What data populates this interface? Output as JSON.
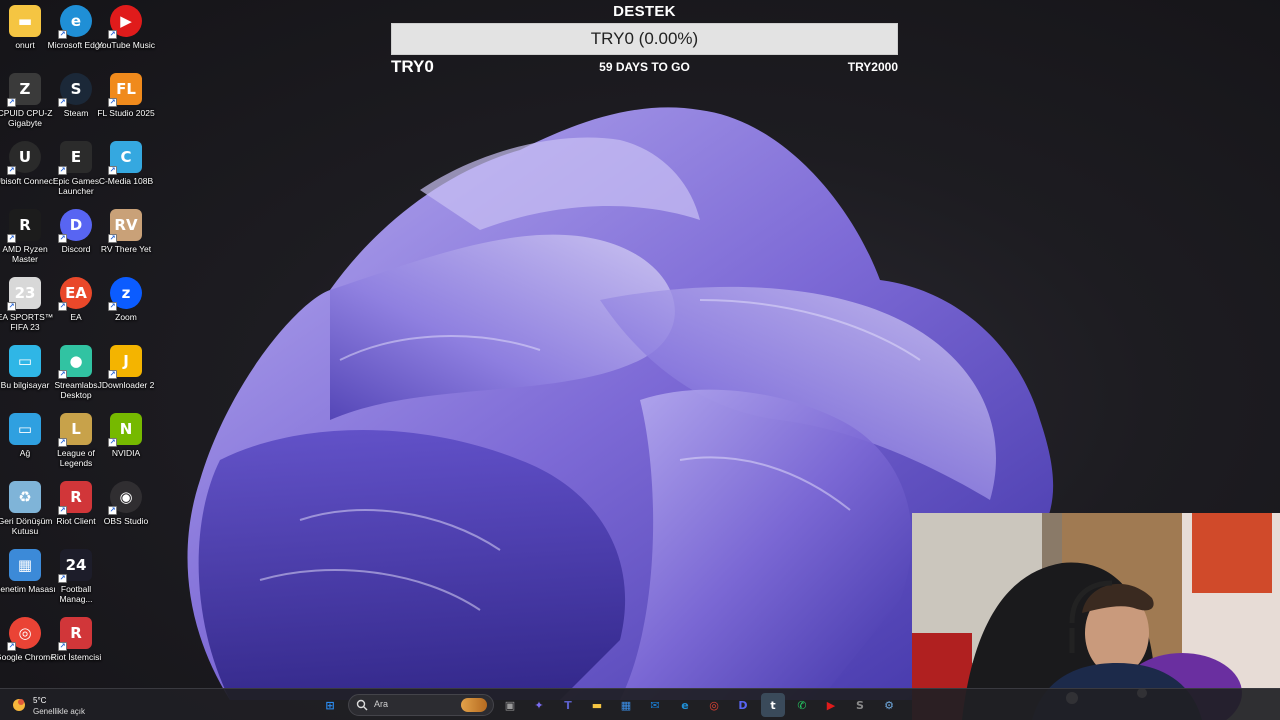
{
  "desktop_icons": [
    {
      "label": "onurt",
      "icon": "folder-icon",
      "color": "#f5c542"
    },
    {
      "label": "Microsoft Edge",
      "icon": "edge-icon",
      "color": "#1f8fd6"
    },
    {
      "label": "YouTube Music",
      "icon": "youtube-music-icon",
      "color": "#e01b1b"
    },
    {
      "label": "CPUID CPU-Z Gigabyte",
      "icon": "cpuz-icon",
      "color": "#3a3a3a"
    },
    {
      "label": "Steam",
      "icon": "steam-icon",
      "color": "#1b2838"
    },
    {
      "label": "FL Studio 2025",
      "icon": "fl-studio-icon",
      "color": "#f08a1c"
    },
    {
      "label": "Ubisoft Connect",
      "icon": "ubisoft-icon",
      "color": "#2a2a2a"
    },
    {
      "label": "Epic Games Launcher",
      "icon": "epic-games-icon",
      "color": "#2b2b2b"
    },
    {
      "label": "C-Media 108B",
      "icon": "cmedia-icon",
      "color": "#35a8e0"
    },
    {
      "label": "AMD Ryzen Master",
      "icon": "amd-ryzen-icon",
      "color": "#1c1c1c"
    },
    {
      "label": "Discord",
      "icon": "discord-icon",
      "color": "#5865f2"
    },
    {
      "label": "RV There Yet",
      "icon": "rv-there-yet-icon",
      "color": "#c9a178"
    },
    {
      "label": "EA SPORTS™ FIFA 23",
      "icon": "fifa-icon",
      "color": "#d8d8d8"
    },
    {
      "label": "EA",
      "icon": "ea-icon",
      "color": "#e9482a"
    },
    {
      "label": "Zoom",
      "icon": "zoom-icon",
      "color": "#0b5cff"
    },
    {
      "label": "Bu bilgisayar",
      "icon": "this-pc-icon",
      "color": "#2fb6e6"
    },
    {
      "label": "Streamlabs Desktop",
      "icon": "streamlabs-icon",
      "color": "#31c3a2"
    },
    {
      "label": "JDownloader 2",
      "icon": "jdownloader-icon",
      "color": "#f4b400"
    },
    {
      "label": "Ağ",
      "icon": "network-icon",
      "color": "#2fa0e0"
    },
    {
      "label": "League of Legends",
      "icon": "league-icon",
      "color": "#c8a24a"
    },
    {
      "label": "NVIDIA",
      "icon": "nvidia-icon",
      "color": "#76b900"
    },
    {
      "label": "Geri Dönüşüm Kutusu",
      "icon": "recycle-bin-icon",
      "color": "#7fb4d8"
    },
    {
      "label": "Riot Client",
      "icon": "riot-client-icon",
      "color": "#d13639"
    },
    {
      "label": "OBS Studio",
      "icon": "obs-icon",
      "color": "#302e31"
    },
    {
      "label": "Denetim Masası",
      "icon": "control-panel-icon",
      "color": "#3c8ad8"
    },
    {
      "label": "Football Manag...",
      "icon": "football-manager-icon",
      "color": "#1d1d2a"
    },
    {
      "label": "",
      "icon": "",
      "color": ""
    },
    {
      "label": "Google Chrome",
      "icon": "chrome-icon",
      "color": "#ea4335"
    },
    {
      "label": "Riot İstemcisi",
      "icon": "riot-istemcisi-icon",
      "color": "#d13639"
    }
  ],
  "donation_goal": {
    "title": "DESTEK",
    "bar_text": "TRY0 (0.00%)",
    "progress_percent": 0,
    "current": "TRY0",
    "days_left": "59 DAYS TO GO",
    "target": "TRY2000",
    "fill_color": "#7f5df0"
  },
  "taskbar": {
    "weather": {
      "temp": "5°C",
      "desc": "Genellikle açık"
    },
    "search_placeholder": "Ara",
    "apps": [
      {
        "icon": "windows-start-icon",
        "color": "#2b8cf0"
      },
      {
        "icon": "task-view-icon",
        "color": "#9a9a9a"
      },
      {
        "icon": "copilot-icon",
        "color": "#7a6cf0"
      },
      {
        "icon": "teams-icon",
        "color": "#5b5fc7"
      },
      {
        "icon": "file-explorer-icon",
        "color": "#f5c542"
      },
      {
        "icon": "microsoft-store-icon",
        "color": "#3a8ee6"
      },
      {
        "icon": "mail-icon",
        "color": "#1a7fd6"
      },
      {
        "icon": "edge-icon",
        "color": "#1f8fd6"
      },
      {
        "icon": "chrome-icon",
        "color": "#ea4335"
      },
      {
        "icon": "discord-icon",
        "color": "#5865f2"
      },
      {
        "icon": "twitter-icon",
        "color": "#1da1f2"
      },
      {
        "icon": "whatsapp-icon",
        "color": "#25d366"
      },
      {
        "icon": "youtube-music-icon",
        "color": "#e01b1b"
      },
      {
        "icon": "steam-icon",
        "color": "#8a8a8a"
      },
      {
        "icon": "settings-app-icon",
        "color": "#6fa8dc"
      }
    ]
  }
}
